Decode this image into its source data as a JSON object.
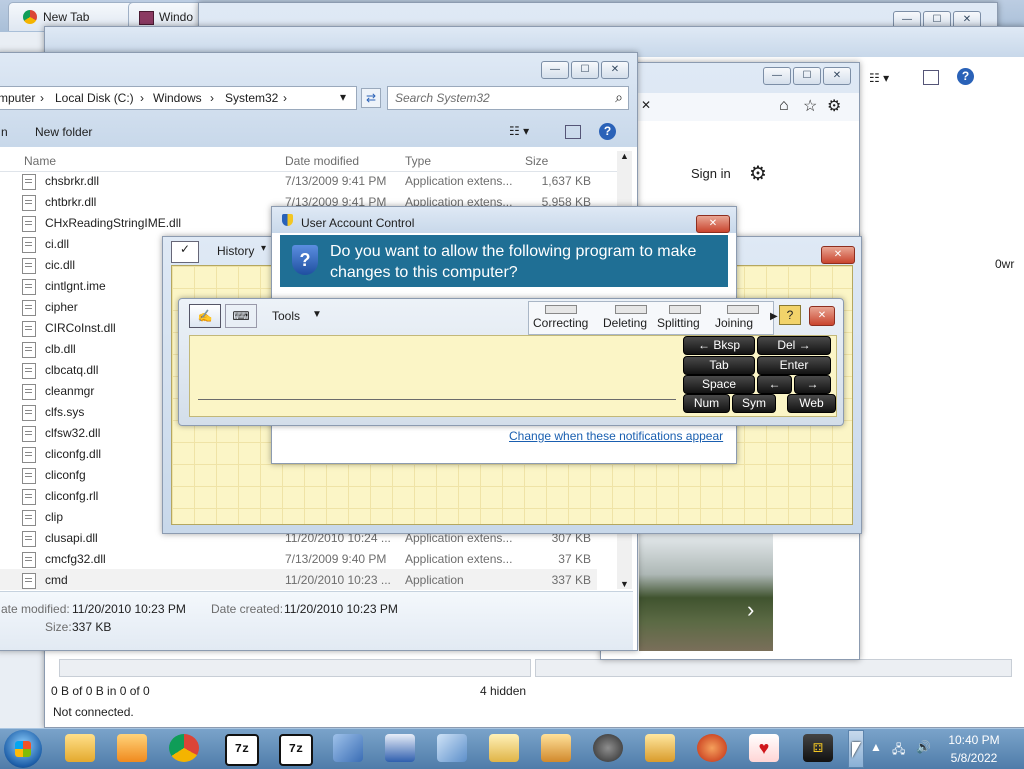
{
  "browser": {
    "tab1": "New Tab",
    "tab2": "Windo",
    "search_placeholder": "puter",
    "signin": "Sign in"
  },
  "explorer": {
    "breadcrumb": [
      "mputer",
      "Local Disk (C:)",
      "Windows",
      "System32"
    ],
    "search_placeholder": "Search System32",
    "toolbar": {
      "left": "n",
      "new_folder": "New folder"
    },
    "columns": {
      "name": "Name",
      "date": "Date modified",
      "type": "Type",
      "size": "Size"
    },
    "files": [
      {
        "name": "chsbrkr.dll",
        "date": "7/13/2009 9:41 PM",
        "type": "Application extens...",
        "size": "1,637 KB"
      },
      {
        "name": "chtbrkr.dll",
        "date": "7/13/2009 9:41 PM",
        "type": "Application extens...",
        "size": "5,958 KB"
      },
      {
        "name": "CHxReadingStringIME.dll",
        "date": "",
        "type": "",
        "size": ""
      },
      {
        "name": "ci.dll",
        "date": "",
        "type": "",
        "size": ""
      },
      {
        "name": "cic.dll",
        "date": "",
        "type": "",
        "size": ""
      },
      {
        "name": "cintlgnt.ime",
        "date": "",
        "type": "",
        "size": ""
      },
      {
        "name": "cipher",
        "date": "",
        "type": "",
        "size": ""
      },
      {
        "name": "CIRCoInst.dll",
        "date": "",
        "type": "",
        "size": ""
      },
      {
        "name": "clb.dll",
        "date": "",
        "type": "",
        "size": ""
      },
      {
        "name": "clbcatq.dll",
        "date": "",
        "type": "",
        "size": ""
      },
      {
        "name": "cleanmgr",
        "date": "",
        "type": "",
        "size": ""
      },
      {
        "name": "clfs.sys",
        "date": "",
        "type": "",
        "size": ""
      },
      {
        "name": "clfsw32.dll",
        "date": "",
        "type": "",
        "size": ""
      },
      {
        "name": "cliconfg.dll",
        "date": "",
        "type": "",
        "size": ""
      },
      {
        "name": "cliconfg",
        "date": "",
        "type": "",
        "size": ""
      },
      {
        "name": "cliconfg.rll",
        "date": "",
        "type": "",
        "size": ""
      },
      {
        "name": "clip",
        "date": "",
        "type": "",
        "size": ""
      },
      {
        "name": "clusapi.dll",
        "date": "11/20/2010 10:24 ...",
        "type": "Application extens...",
        "size": "307 KB"
      },
      {
        "name": "cmcfg32.dll",
        "date": "7/13/2009 9:40 PM",
        "type": "Application extens...",
        "size": "37 KB"
      },
      {
        "name": "cmd",
        "date": "11/20/2010 10:23 ...",
        "type": "Application",
        "size": "337 KB"
      }
    ],
    "details": {
      "modified_label": "ate modified:",
      "modified": "11/20/2010 10:23 PM",
      "created_label": "Date created:",
      "created": "11/20/2010 10:23 PM",
      "size_label": "Size:",
      "size": "337 KB"
    }
  },
  "back_status": {
    "left": "0 B of 0 B in 0 of 0",
    "hidden": "4 hidden",
    "conn": "Not connected.",
    "side": "0wr"
  },
  "uac": {
    "title": "User Account Control",
    "question": "Do you want to allow the following program to make changes to this computer?",
    "link": "Change when these notifications appear"
  },
  "journal": {
    "history": "History"
  },
  "tip": {
    "tools": "Tools",
    "gestures": [
      "Correcting",
      "Deleting",
      "Splitting",
      "Joining"
    ],
    "keys": [
      {
        "label": "←  Bksp",
        "w": 70
      },
      {
        "label": "Del  →",
        "w": 72
      },
      {
        "label": "Tab",
        "w": 70
      },
      {
        "label": "Enter",
        "w": 72
      },
      {
        "label": "Space",
        "w": 70
      },
      {
        "label": "←",
        "w": 33
      },
      {
        "label": "→",
        "w": 35
      },
      {
        "label": "Num",
        "w": 45
      },
      {
        "label": "Sym",
        "w": 42
      },
      {
        "label": "Web",
        "w": 47
      }
    ]
  },
  "clock": {
    "time": "10:40 PM",
    "date": "5/8/2022"
  },
  "colors": {
    "accent": "#1f6f95",
    "taskbar": "#5f8bb8",
    "close": "#c9452e",
    "tip_bg": "#fbf5c6"
  }
}
